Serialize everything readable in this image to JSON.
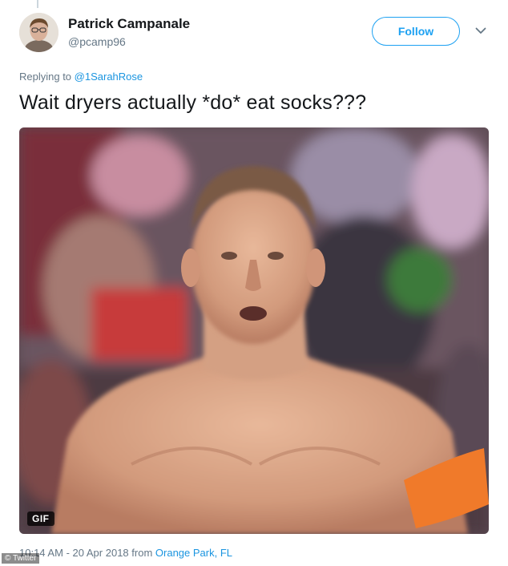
{
  "user": {
    "display_name": "Patrick Campanale",
    "handle": "@pcamp96",
    "avatar_icon": "user-avatar"
  },
  "follow_button": {
    "label": "Follow",
    "color": "#1da1f2"
  },
  "menu_icon": "chevron-down-icon",
  "reply": {
    "prefix": "Replying to",
    "mention": "@1SarahRose"
  },
  "tweet": {
    "text": "Wait dryers actually *do* eat socks???"
  },
  "media": {
    "type": "gif",
    "badge": "GIF"
  },
  "footer": {
    "time": "10:14 AM",
    "separator": "-",
    "date": "20 Apr 2018",
    "from": "from",
    "location": "Orange Park, FL"
  },
  "watermark": "© Twitter",
  "colors": {
    "link": "#1b95e0",
    "secondary_text": "#657786",
    "primary_text": "#14171a"
  }
}
